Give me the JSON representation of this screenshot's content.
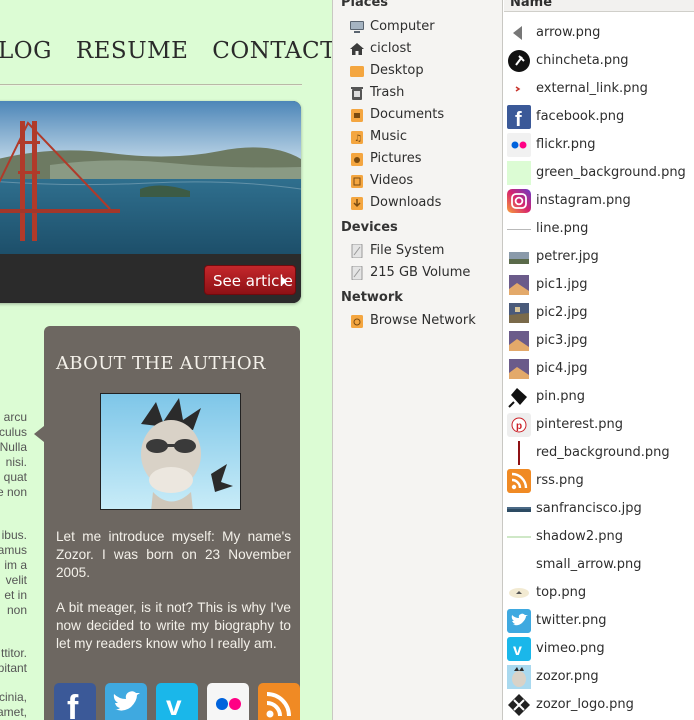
{
  "webpage": {
    "nav": [
      "LOG",
      "RESUME",
      "CONTACT"
    ],
    "see_article": "See article",
    "body_fragments": [
      "arcu",
      "culus",
      "Nulla",
      "nisi.",
      "quat",
      "e non",
      "ibus.",
      "amus",
      "im a",
      "velit",
      "et in",
      "non",
      "ttitor.",
      "pitant",
      "cinia,",
      "amet,"
    ],
    "author": {
      "heading": "ABOUT THE AUTHOR",
      "p1": "Let me introduce myself: My name's Zozor. I was born on 23 November 2005.",
      "p2": "A bit meager, is it not? This is why I've now decided to write my biography to let my readers know who I really am."
    },
    "social_icons": [
      "facebook-icon",
      "twitter-icon",
      "vimeo-icon",
      "flickr-icon",
      "rss-icon"
    ],
    "colors": {
      "page_bg": "#dcfcd4",
      "author_bg": "#6d6761",
      "button_red": "#b41d22"
    }
  },
  "sidebar": {
    "sections": [
      {
        "title": "Places",
        "items": [
          {
            "label": "Computer",
            "icon": "computer-icon"
          },
          {
            "label": "ciclost",
            "icon": "home-icon"
          },
          {
            "label": "Desktop",
            "icon": "desktop-folder-icon"
          },
          {
            "label": "Trash",
            "icon": "trash-icon"
          },
          {
            "label": "Documents",
            "icon": "documents-folder-icon"
          },
          {
            "label": "Music",
            "icon": "music-folder-icon"
          },
          {
            "label": "Pictures",
            "icon": "pictures-folder-icon"
          },
          {
            "label": "Videos",
            "icon": "videos-folder-icon"
          },
          {
            "label": "Downloads",
            "icon": "downloads-folder-icon"
          }
        ]
      },
      {
        "title": "Devices",
        "items": [
          {
            "label": "File System",
            "icon": "drive-icon"
          },
          {
            "label": "215 GB Volume",
            "icon": "drive-icon"
          }
        ]
      },
      {
        "title": "Network",
        "items": [
          {
            "label": "Browse Network",
            "icon": "network-icon"
          }
        ]
      }
    ]
  },
  "filelist": {
    "column_header": "Name",
    "files": [
      {
        "name": "arrow.png",
        "icon": "arrow-thumb"
      },
      {
        "name": "chincheta.png",
        "icon": "pin-thumb"
      },
      {
        "name": "external_link.png",
        "icon": "external-link-thumb"
      },
      {
        "name": "facebook.png",
        "icon": "facebook-thumb"
      },
      {
        "name": "flickr.png",
        "icon": "flickr-thumb"
      },
      {
        "name": "green_background.png",
        "icon": "green-bg-thumb"
      },
      {
        "name": "instagram.png",
        "icon": "instagram-thumb"
      },
      {
        "name": "line.png",
        "icon": "line-thumb"
      },
      {
        "name": "petrer.jpg",
        "icon": "photo-thumb"
      },
      {
        "name": "pic1.jpg",
        "icon": "photo-thumb"
      },
      {
        "name": "pic2.jpg",
        "icon": "photo-thumb"
      },
      {
        "name": "pic3.jpg",
        "icon": "photo-thumb"
      },
      {
        "name": "pic4.jpg",
        "icon": "photo-thumb"
      },
      {
        "name": "pin.png",
        "icon": "pin-black-thumb"
      },
      {
        "name": "pinterest.png",
        "icon": "pinterest-thumb"
      },
      {
        "name": "red_background.png",
        "icon": "red-bg-thumb"
      },
      {
        "name": "rss.png",
        "icon": "rss-thumb"
      },
      {
        "name": "sanfrancisco.jpg",
        "icon": "landscape-thumb"
      },
      {
        "name": "shadow2.png",
        "icon": "shadow-thumb"
      },
      {
        "name": "small_arrow.png",
        "icon": "small-arrow-thumb"
      },
      {
        "name": "top.png",
        "icon": "top-thumb"
      },
      {
        "name": "twitter.png",
        "icon": "twitter-thumb"
      },
      {
        "name": "vimeo.png",
        "icon": "vimeo-thumb"
      },
      {
        "name": "zozor.png",
        "icon": "zozor-thumb"
      },
      {
        "name": "zozor_logo.png",
        "icon": "zozor-logo-thumb"
      }
    ]
  }
}
